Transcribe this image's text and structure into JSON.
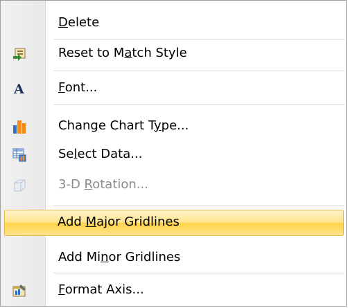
{
  "menu": {
    "items": [
      {
        "id": "delete",
        "pre": "",
        "acc": "D",
        "post": "elete",
        "icon": "none",
        "enabled": true
      },
      {
        "id": "reset",
        "pre": "Reset to M",
        "acc": "a",
        "post": "tch Style",
        "icon": "reset-style-icon",
        "enabled": true
      },
      {
        "id": "font",
        "pre": "",
        "acc": "F",
        "post": "ont...",
        "icon": "font-icon",
        "enabled": true
      },
      {
        "id": "change-chart",
        "pre": "Change Chart T",
        "acc": "y",
        "post": "pe...",
        "icon": "chart-icon",
        "enabled": true
      },
      {
        "id": "select-data",
        "pre": "Se",
        "acc": "l",
        "post": "ect Data...",
        "icon": "select-data-icon",
        "enabled": true
      },
      {
        "id": "rotation",
        "pre": "3-D ",
        "acc": "R",
        "post": "otation...",
        "icon": "cube-icon",
        "enabled": false
      },
      {
        "id": "major",
        "pre": "Add ",
        "acc": "M",
        "post": "ajor Gridlines",
        "icon": "none",
        "enabled": true,
        "highlighted": true
      },
      {
        "id": "minor",
        "pre": "Add Mi",
        "acc": "n",
        "post": "or Gridlines",
        "icon": "none",
        "enabled": true
      },
      {
        "id": "format-axis",
        "pre": "",
        "acc": "F",
        "post": "ormat Axis...",
        "icon": "format-axis-icon",
        "enabled": true
      }
    ]
  },
  "colors": {
    "highlight_top": "#fff5cc",
    "highlight_bottom": "#ffd24a",
    "highlight_border": "#e3b94b",
    "disabled_text": "#8c8c8c",
    "chart_orange": "#f08a1a",
    "chart_blue": "#2f6fc9"
  }
}
